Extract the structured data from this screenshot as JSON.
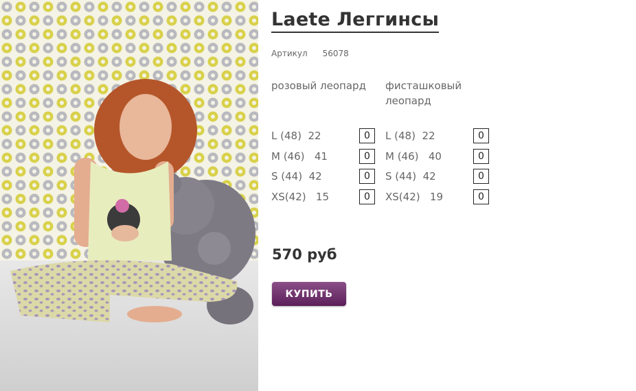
{
  "product": {
    "title": "Laete Леггинсы",
    "article_label": "Артикул",
    "article_code": "56078",
    "price": "570 руб",
    "buy_label": "КУПИТЬ"
  },
  "colors": [
    {
      "name": "розовый леопард",
      "sizes": [
        {
          "label": "L (48)",
          "stock": "22",
          "qty": "0"
        },
        {
          "label": "M (46)",
          "stock": "41",
          "qty": "0"
        },
        {
          "label": "S (44)",
          "stock": "42",
          "qty": "0"
        },
        {
          "label": "XS(42)",
          "stock": "15",
          "qty": "0"
        }
      ]
    },
    {
      "name": "фисташковый леопард",
      "sizes": [
        {
          "label": "L (48)",
          "stock": "22",
          "qty": "0"
        },
        {
          "label": "M (46)",
          "stock": "40",
          "qty": "0"
        },
        {
          "label": "S (44)",
          "stock": "42",
          "qty": "0"
        },
        {
          "label": "XS(42)",
          "stock": "19",
          "qty": "0"
        }
      ]
    }
  ],
  "theme": {
    "accent": "#6b2a68",
    "text": "#333333",
    "muted": "#666666"
  }
}
